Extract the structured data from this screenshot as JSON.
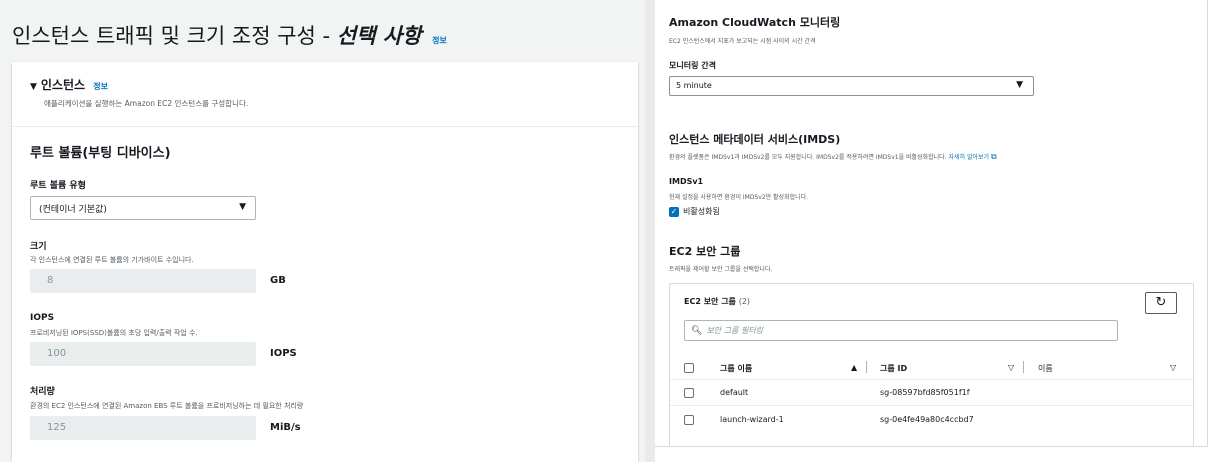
{
  "left": {
    "page_title": "인스턴스 트래픽 및 크기 조정 구성 -",
    "page_title_em": "선택 사항",
    "info": "정보",
    "section_title": "인스턴스",
    "section_desc": "애플리케이션을 실행하는 Amazon EC2 인스턴스를 구성합니다.",
    "root_volume_heading": "루트 볼륨(부팅 디바이스)",
    "root_volume_type_label": "루트 볼륨 유형",
    "root_volume_type_value": "(컨테이너 기본값)",
    "size_label": "크기",
    "size_desc": "각 인스턴스에 연결된 루트 볼륨의 기가바이트 수입니다.",
    "size_value": "8",
    "size_unit": "GB",
    "iops_label": "IOPS",
    "iops_desc": "프로비저닝된 IOPS(SSD)볼륨의 초당 입력/출력 작업 수.",
    "iops_value": "100",
    "iops_unit": "IOPS",
    "throughput_label": "처리량",
    "throughput_desc": "환경의 EC2 인스턴스에 연결된 Amazon EBS 루트 볼륨을 프로비저닝하는 데 필요한 처리량",
    "throughput_value": "125",
    "throughput_unit": "MiB/s"
  },
  "right": {
    "cw_title": "Amazon CloudWatch 모니터링",
    "cw_desc": "EC2 인스턴스에서 지표가 보고되는 시점 사이의 시간 간격",
    "interval_label": "모니터링 간격",
    "interval_value": "5 minute",
    "imds_title": "인스턴스 메타데이터 서비스(IMDS)",
    "imds_desc": "환경의 플랫폼은 IMDSv1과 IMDSv2를 모두 지원합니다. IMDSv2를 적용하려면 IMDSv1을 비활성화합니다.",
    "imds_link": "자세히 알아보기",
    "imdsv1_label": "IMDSv1",
    "imdsv1_desc": "현재 설정을 사용하면 환경이 IMDSv2만 활성화합니다.",
    "imdsv1_checkbox": "비활성화됨",
    "sg_heading": "EC2 보안 그룹",
    "sg_desc": "트래픽을 제어할 보안 그룹을 선택합니다.",
    "sg_table_title": "EC2 보안 그룹",
    "sg_count": "(2)",
    "filter_placeholder": "보안 그룹 필터링",
    "columns": [
      "그룹 이름",
      "그룹 ID",
      "이름"
    ],
    "rows": [
      {
        "name": "default",
        "id": "sg-08597bfd85f051f1f"
      },
      {
        "name": "launch-wizard-1",
        "id": "sg-0e4fe49a80c4ccbd7"
      }
    ]
  },
  "colors": {
    "accent": "#0073bb",
    "text": "#16191f",
    "muted": "#545b64"
  }
}
